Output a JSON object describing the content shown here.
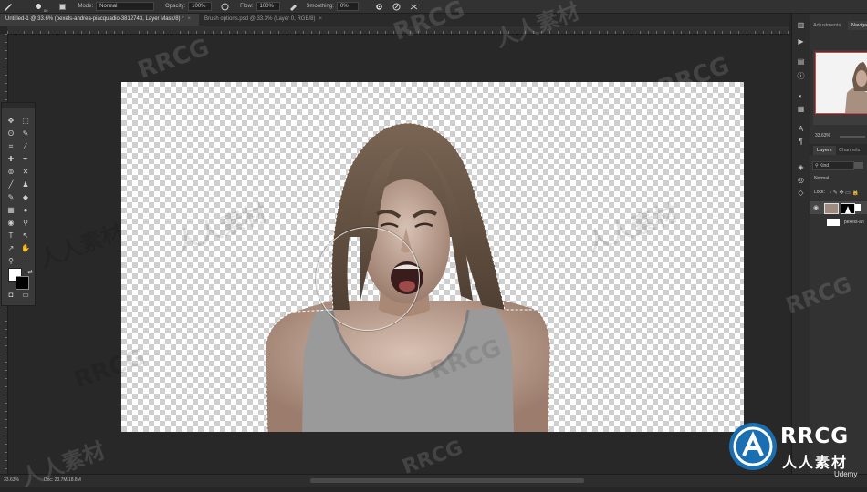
{
  "options_bar": {
    "brush_size": "60",
    "mode_label": "Mode:",
    "mode_value": "Normal",
    "opacity_label": "Opacity:",
    "opacity_value": "100%",
    "flow_label": "Flow:",
    "flow_value": "100%",
    "smoothing_label": "Smoothing:",
    "smoothing_value": "0%"
  },
  "tabs": [
    {
      "label": "Untitled-1 @ 33.6% (pexels-andrea-piacquadio-3812743, Layer Mask/8) *",
      "close": "×"
    },
    {
      "label": "Brush options.psd @ 33.3% (Layer 0, RGB/8)",
      "close": "×"
    }
  ],
  "right_panel": {
    "tabs": [
      "Adjustments",
      "Navigator"
    ],
    "zoom": "33.63%",
    "layers_tabs": [
      "Layers",
      "Channels"
    ],
    "kind_label": "Kind",
    "blend_mode": "Normal",
    "lock_label": "Lock:",
    "layer_name": "pexels-an"
  },
  "status_bar": {
    "zoom": "33.63%",
    "doc_info": "Doc: 23.7M/18.8M"
  },
  "watermarks": [
    "RRCG",
    "人人素材"
  ],
  "logo": {
    "title": "RRCG",
    "subtitle": "人人素材",
    "brand": "Udemy"
  },
  "colors": {
    "accent": "#d94545",
    "canvas_bg": "#282828"
  }
}
